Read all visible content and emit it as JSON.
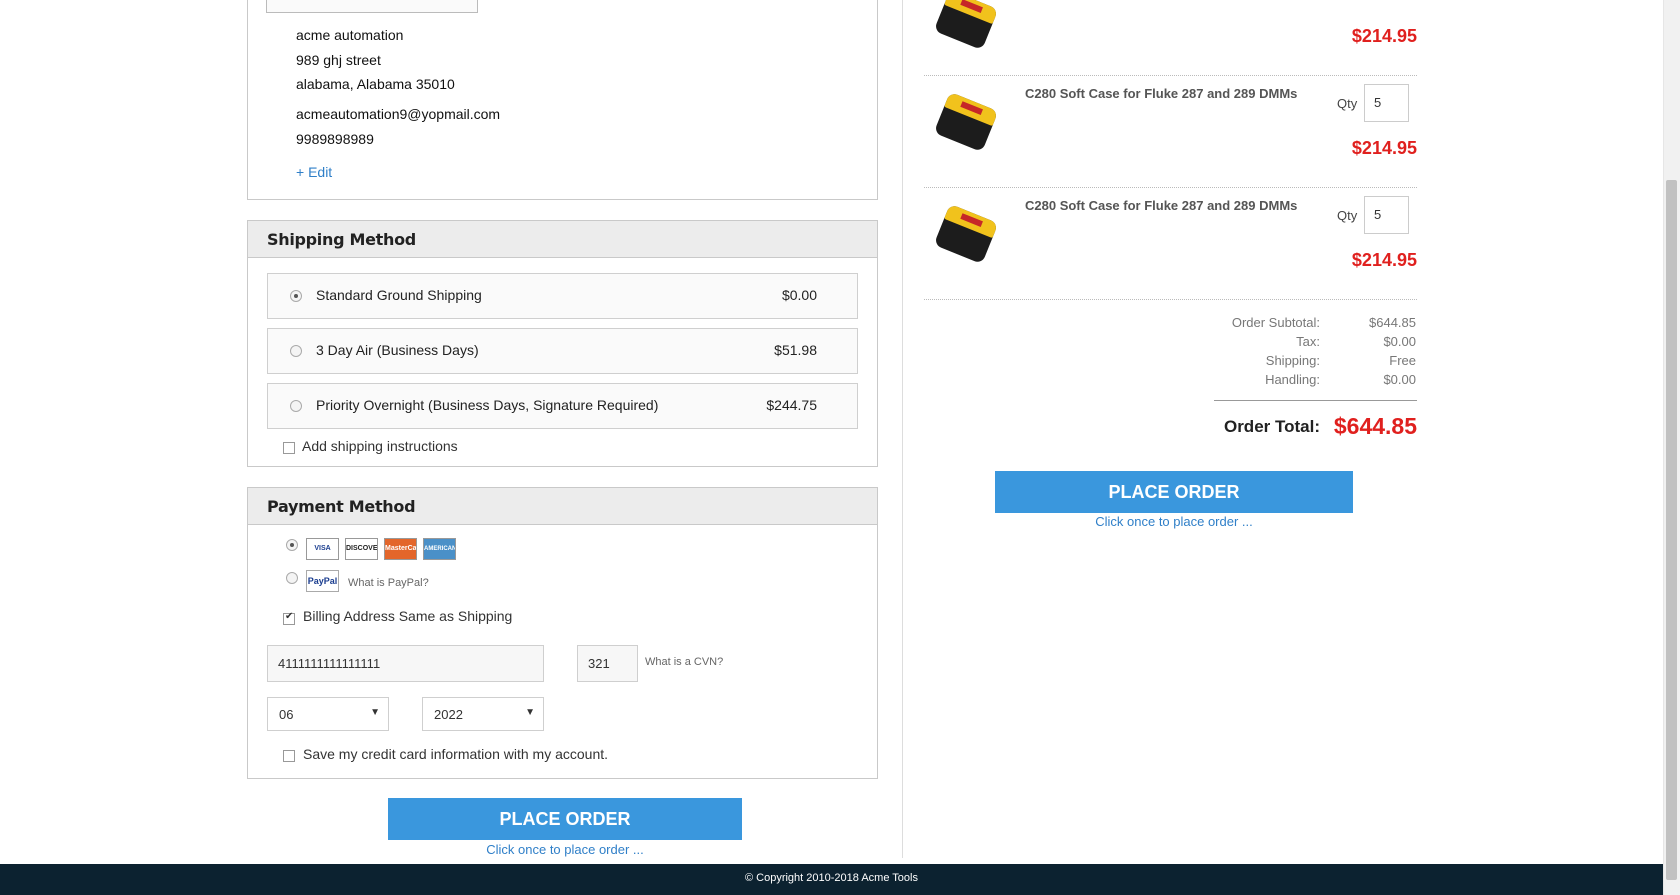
{
  "address": {
    "company": "acme automation",
    "street": "989 ghj street",
    "city_state_zip": "alabama, Alabama 35010",
    "email": "acmeautomation9@yopmail.com",
    "phone": "9989898989",
    "edit_label": "+ Edit"
  },
  "shipping": {
    "title": "Shipping Method",
    "options": [
      {
        "label": "Standard Ground Shipping",
        "price": "$0.00",
        "selected": true
      },
      {
        "label": "3 Day Air (Business Days)",
        "price": "$51.98",
        "selected": false
      },
      {
        "label": "Priority Overnight (Business Days, Signature Required)",
        "price": "$244.75",
        "selected": false
      }
    ],
    "instructions_label": "Add shipping instructions"
  },
  "payment": {
    "title": "Payment Method",
    "card_logos": [
      "VISA",
      "DISCOVER",
      "MasterCard",
      "AMERICAN EXPRESS"
    ],
    "paypal_logo": "PayPal",
    "what_is_paypal": "What is PayPal?",
    "billing_same_label": "Billing Address Same as Shipping",
    "card_number": "4111111111111111",
    "cvn": "321",
    "what_is_cvn": "What is a CVN?",
    "exp_month": "06",
    "exp_year": "2022",
    "save_card_label": "Save my credit card information with my account."
  },
  "actions": {
    "place_order_label": "PLACE ORDER",
    "place_order_note": "Click once to place order ..."
  },
  "cart": {
    "qty_label": "Qty",
    "items": [
      {
        "name": "",
        "qty": "",
        "price": "$214.95"
      },
      {
        "name": "C280 Soft Case for Fluke 287 and 289 DMMs",
        "qty": "5",
        "price": "$214.95"
      },
      {
        "name": "C280 Soft Case for Fluke 287 and 289 DMMs",
        "qty": "5",
        "price": "$214.95"
      }
    ],
    "product_image_brand": "FLUKE"
  },
  "totals": {
    "subtotal_label": "Order Subtotal:",
    "subtotal": "$644.85",
    "tax_label": "Tax:",
    "tax": "$0.00",
    "shipping_label": "Shipping:",
    "shipping": "Free",
    "handling_label": "Handling:",
    "handling": "$0.00",
    "total_label": "Order Total:",
    "total": "$644.85"
  },
  "footer": {
    "copyright": "© Copyright 2010-2018 Acme Tools"
  },
  "colors": {
    "accent": "#3a97dd",
    "price_red": "#e0201e",
    "footer_bg": "#0c2230",
    "link": "#2f7fc8"
  }
}
